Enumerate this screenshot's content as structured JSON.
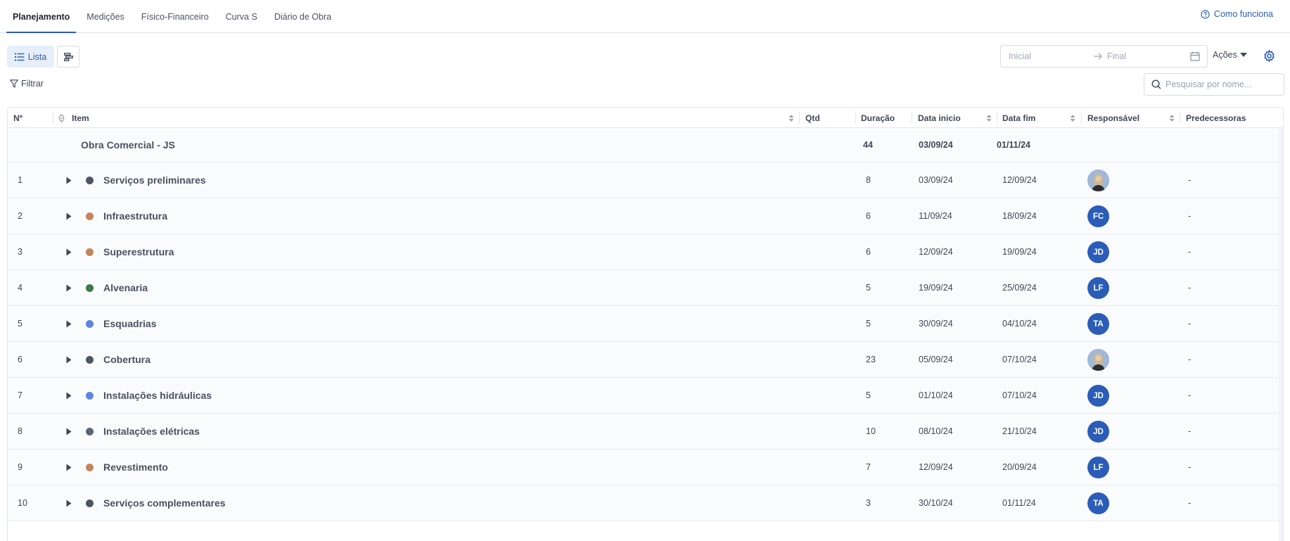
{
  "tabs": [
    "Planejamento",
    "Medições",
    "Físico-Financeiro",
    "Curva S",
    "Diário de Obra"
  ],
  "help_label": "Como funciona",
  "view": {
    "list_label": "Lista"
  },
  "date_range": {
    "start_placeholder": "Inicial",
    "end_placeholder": "Final"
  },
  "actions_label": "Ações",
  "filter_label": "Filtrar",
  "search_placeholder": "Pesquisar por nome...",
  "columns": {
    "num": "Nº",
    "item": "Item",
    "qtd": "Qtd",
    "duracao": "Duração",
    "data_inicio": "Data inicio",
    "data_fim": "Data fim",
    "responsavel": "Responsável",
    "predecessoras": "Predecessoras"
  },
  "root": {
    "name": "Obra Comercial - JS",
    "duration": "44",
    "start": "03/09/24",
    "end": "01/11/24"
  },
  "rows": [
    {
      "num": "1",
      "name": "Serviços preliminares",
      "color": "#4e5566",
      "duration": "8",
      "start": "03/09/24",
      "end": "12/09/24",
      "responsible": "",
      "photo": true,
      "pred": "-"
    },
    {
      "num": "2",
      "name": "Infraestrutura",
      "color": "#c4855c",
      "duration": "6",
      "start": "11/09/24",
      "end": "18/09/24",
      "responsible": "FC",
      "photo": false,
      "pred": "-"
    },
    {
      "num": "3",
      "name": "Superestrutura",
      "color": "#c4855c",
      "duration": "6",
      "start": "12/09/24",
      "end": "19/09/24",
      "responsible": "JD",
      "photo": false,
      "pred": "-"
    },
    {
      "num": "4",
      "name": "Alvenaria",
      "color": "#3f7a45",
      "duration": "5",
      "start": "19/09/24",
      "end": "25/09/24",
      "responsible": "LF",
      "photo": false,
      "pred": "-"
    },
    {
      "num": "5",
      "name": "Esquadrias",
      "color": "#5b86e0",
      "duration": "5",
      "start": "30/09/24",
      "end": "04/10/24",
      "responsible": "TA",
      "photo": false,
      "pred": "-"
    },
    {
      "num": "6",
      "name": "Cobertura",
      "color": "#4e5566",
      "duration": "23",
      "start": "05/09/24",
      "end": "07/10/24",
      "responsible": "",
      "photo": true,
      "pred": "-"
    },
    {
      "num": "7",
      "name": "Instalações hidráulicas",
      "color": "#5b86e0",
      "duration": "5",
      "start": "01/10/24",
      "end": "07/10/24",
      "responsible": "JD",
      "photo": false,
      "pred": "-"
    },
    {
      "num": "8",
      "name": "Instalações elétricas",
      "color": "#5b6677",
      "duration": "10",
      "start": "08/10/24",
      "end": "21/10/24",
      "responsible": "JD",
      "photo": false,
      "pred": "-"
    },
    {
      "num": "9",
      "name": "Revestimento",
      "color": "#c4855c",
      "duration": "7",
      "start": "12/09/24",
      "end": "20/09/24",
      "responsible": "LF",
      "photo": false,
      "pred": "-"
    },
    {
      "num": "10",
      "name": "Serviços complementares",
      "color": "#4e5566",
      "duration": "3",
      "start": "30/10/24",
      "end": "01/11/24",
      "responsible": "TA",
      "photo": false,
      "pred": "-"
    }
  ]
}
